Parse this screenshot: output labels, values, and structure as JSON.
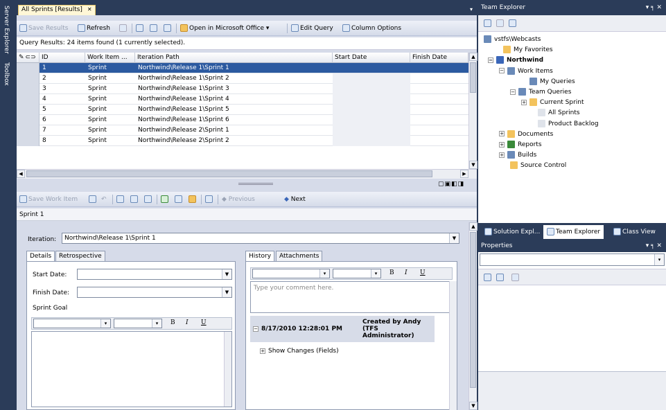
{
  "rail": {
    "server_explorer": "Server Explorer",
    "toolbox": "Toolbox"
  },
  "document": {
    "tab_title": "All Sprints [Results]",
    "close_glyph": "✕",
    "toolbar": {
      "save_results": "Save Results",
      "refresh": "Refresh",
      "open_office": "Open in Microsoft Office ▾",
      "edit_query": "Edit Query",
      "column_options": "Column Options"
    },
    "status": "Query Results: 24 items found (1 currently selected).",
    "columns": [
      "ID",
      "Work Item ...",
      "Iteration Path",
      "Start Date",
      "Finish Date"
    ],
    "rows": [
      {
        "id": "1",
        "type": "Sprint",
        "path": "Northwind\\Release 1\\Sprint 1"
      },
      {
        "id": "2",
        "type": "Sprint",
        "path": "Northwind\\Release 1\\Sprint 2"
      },
      {
        "id": "3",
        "type": "Sprint",
        "path": "Northwind\\Release 1\\Sprint 3"
      },
      {
        "id": "4",
        "type": "Sprint",
        "path": "Northwind\\Release 1\\Sprint 4"
      },
      {
        "id": "5",
        "type": "Sprint",
        "path": "Northwind\\Release 1\\Sprint 5"
      },
      {
        "id": "6",
        "type": "Sprint",
        "path": "Northwind\\Release 1\\Sprint 6"
      },
      {
        "id": "7",
        "type": "Sprint",
        "path": "Northwind\\Release 2\\Sprint 1"
      },
      {
        "id": "8",
        "type": "Sprint",
        "path": "Northwind\\Release 2\\Sprint 2"
      }
    ],
    "selected_row_index": 0
  },
  "workitem": {
    "toolbar": {
      "save": "Save Work Item",
      "previous": "Previous",
      "next": "Next"
    },
    "title": "Sprint 1",
    "iteration_label": "Iteration:",
    "iteration_value": "Northwind\\Release 1\\Sprint 1",
    "tabs_left": [
      "Details",
      "Retrospective"
    ],
    "start_date_label": "Start Date:",
    "finish_date_label": "Finish Date:",
    "sprint_goal_label": "Sprint Goal",
    "tabs_right": [
      "History",
      "Attachments"
    ],
    "comment_placeholder": "Type your comment here.",
    "history_date": "8/17/2010 12:28:01 PM",
    "history_author": "Created by Andy (TFS Administrator)",
    "show_changes": "Show Changes (Fields)",
    "rte": {
      "bold": "B",
      "italic": "I",
      "underline": "U"
    }
  },
  "team_explorer": {
    "title": "Team Explorer",
    "controls": "▾ ╕ ✕",
    "tree": [
      {
        "label": "vstfs\\Webcasts",
        "bold": false
      },
      {
        "label": "My Favorites",
        "bold": false
      },
      {
        "label": "Northwind",
        "bold": true
      },
      {
        "label": "Work Items",
        "bold": false
      },
      {
        "label": "My Queries",
        "bold": false
      },
      {
        "label": "Team Queries",
        "bold": false
      },
      {
        "label": "Current Sprint",
        "bold": false
      },
      {
        "label": "All Sprints",
        "bold": false
      },
      {
        "label": "Product Backlog",
        "bold": false
      },
      {
        "label": "Documents",
        "bold": false
      },
      {
        "label": "Reports",
        "bold": false
      },
      {
        "label": "Builds",
        "bold": false
      },
      {
        "label": "Source Control",
        "bold": false
      }
    ],
    "bottom_tabs": [
      "Solution Expl...",
      "Team Explorer",
      "Class View"
    ]
  },
  "properties": {
    "title": "Properties",
    "controls": "▾ ╕ ✕"
  },
  "colors": {
    "selection": "#2c5aa0",
    "chrome": "#2b3c59",
    "tab_active": "#fff7d7"
  }
}
